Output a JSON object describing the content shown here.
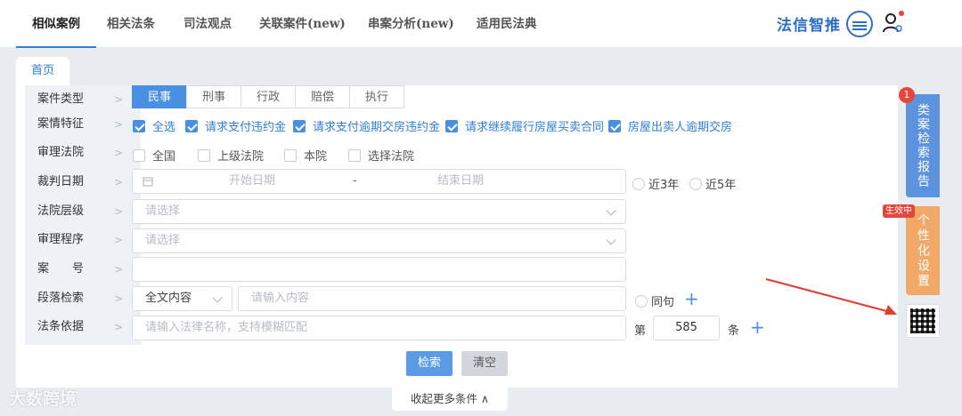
{
  "nav": {
    "tabs": [
      {
        "label": "相似案例"
      },
      {
        "label": "相关法条"
      },
      {
        "label": "司法观点"
      },
      {
        "label": "关联案件(new)"
      },
      {
        "label": "串案分析(new)"
      },
      {
        "label": "适用民法典"
      }
    ],
    "brand": "法信智推"
  },
  "breadcrumb": {
    "home": "首页"
  },
  "filters": {
    "labels": [
      "案件类型",
      "案情特征",
      "审理法院",
      "裁判日期",
      "法院层级",
      "审理程序",
      "案　　号",
      "段落检索",
      "法条依据"
    ],
    "case_types": [
      "民事",
      "刑事",
      "行政",
      "赔偿",
      "执行"
    ],
    "features": [
      "全选",
      "请求支付违约金",
      "请求支付逾期交房违约金",
      "请求继续履行房屋买卖合同",
      "房屋出卖人逾期交房"
    ],
    "courts": [
      "全国",
      "上级法院",
      "本院",
      "选择法院"
    ],
    "date_start": "开始日期",
    "date_sep": "-",
    "date_end": "结束日期",
    "recent": [
      "近3年",
      "近5年"
    ],
    "select_placeholder": "请选择",
    "paragraph_scope": "全文内容",
    "paragraph_placeholder": "请输入内容",
    "same_sentence": "同句",
    "law_placeholder": "请输入法律名称，支持模糊匹配",
    "article_prefix": "第",
    "article_value": "585",
    "article_suffix": "条"
  },
  "actions": {
    "search": "检索",
    "clear": "清空",
    "collapse": "收起更多条件 ∧"
  },
  "side": {
    "report": "类案检索报告",
    "report_badge": "1",
    "settings": "个性化设置",
    "settings_tag": "生效中"
  },
  "watermark": "大数跨境",
  "colors": {
    "primary": "#4a90e2",
    "accent_orange": "#f2a866",
    "badge_red": "#e6453c"
  }
}
